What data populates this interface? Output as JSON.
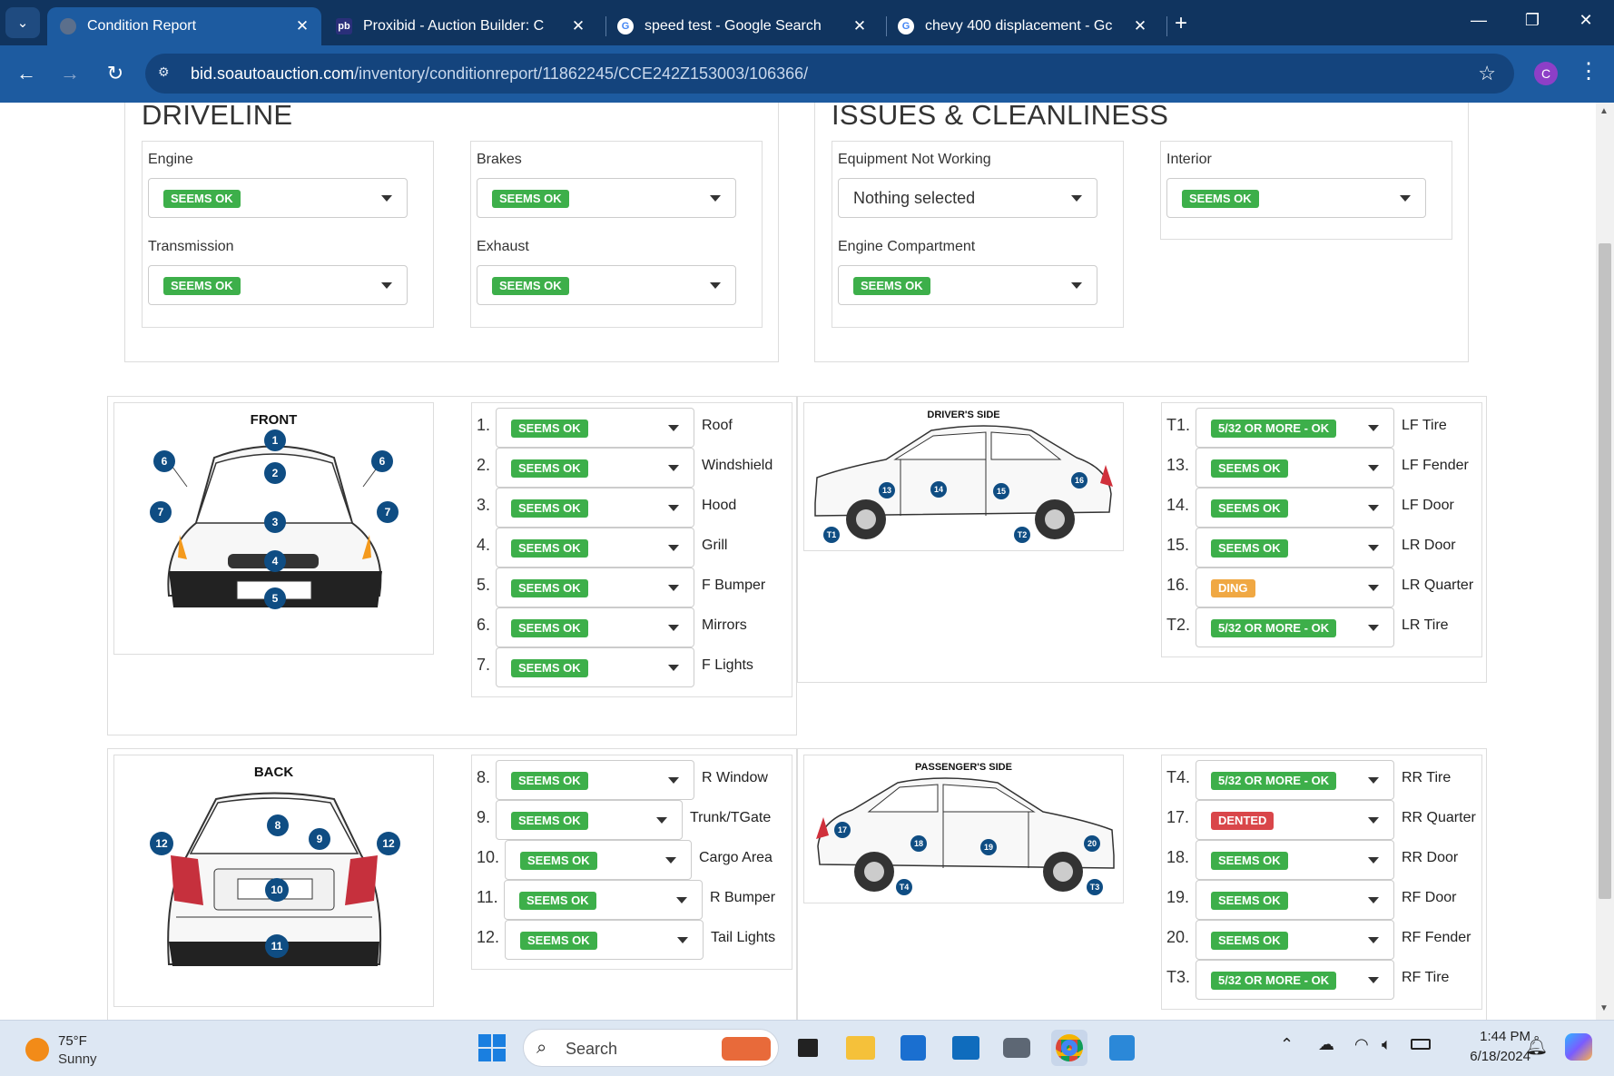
{
  "browser": {
    "tabs": [
      {
        "title": "Condition Report",
        "active": true,
        "favicon": "globe-icon"
      },
      {
        "title": "Proxibid - Auction Builder: C",
        "active": false,
        "favicon": "proxibid-icon"
      },
      {
        "title": "speed test - Google Search",
        "active": false,
        "favicon": "google-icon"
      },
      {
        "title": "chevy 400 displacement - Gc",
        "active": false,
        "favicon": "google-icon"
      }
    ],
    "url_host": "bid.soautoauction.com",
    "url_path": "/inventory/conditionreport/11862245/CCE242Z153003/106366/",
    "profile_initial": "C"
  },
  "colors": {
    "chrome_dark": "#10345f",
    "chrome": "#1d5ba0",
    "ok": "#3daf4a",
    "warn": "#f0a843",
    "bad": "#d9464a"
  },
  "driveline": {
    "title": "DRIVELINE",
    "engine": {
      "label": "Engine",
      "value": "SEEMS OK"
    },
    "brakes": {
      "label": "Brakes",
      "value": "SEEMS OK"
    },
    "transmission": {
      "label": "Transmission",
      "value": "SEEMS OK"
    },
    "exhaust": {
      "label": "Exhaust",
      "value": "SEEMS OK"
    }
  },
  "issues": {
    "title": "ISSUES & CLEANLINESS",
    "equipment": {
      "label": "Equipment Not Working",
      "value": "Nothing selected"
    },
    "interior": {
      "label": "Interior",
      "value": "SEEMS OK"
    },
    "engine_compartment": {
      "label": "Engine Compartment",
      "value": "SEEMS OK"
    }
  },
  "front": {
    "title": "FRONT",
    "items": [
      {
        "num": "1.",
        "value": "SEEMS OK",
        "part": "Roof"
      },
      {
        "num": "2.",
        "value": "SEEMS OK",
        "part": "Windshield"
      },
      {
        "num": "3.",
        "value": "SEEMS OK",
        "part": "Hood"
      },
      {
        "num": "4.",
        "value": "SEEMS OK",
        "part": "Grill"
      },
      {
        "num": "5.",
        "value": "SEEMS OK",
        "part": "F Bumper"
      },
      {
        "num": "6.",
        "value": "SEEMS OK",
        "part": "Mirrors"
      },
      {
        "num": "7.",
        "value": "SEEMS OK",
        "part": "F Lights"
      }
    ]
  },
  "drivers_side": {
    "title": "DRIVER'S SIDE",
    "items": [
      {
        "num": "T1.",
        "value": "5/32 OR MORE - OK",
        "part": "LF Tire",
        "status": "ok"
      },
      {
        "num": "13.",
        "value": "SEEMS OK",
        "part": "LF Fender",
        "status": "ok"
      },
      {
        "num": "14.",
        "value": "SEEMS OK",
        "part": "LF Door",
        "status": "ok"
      },
      {
        "num": "15.",
        "value": "SEEMS OK",
        "part": "LR Door",
        "status": "ok"
      },
      {
        "num": "16.",
        "value": "DING",
        "part": "LR Quarter",
        "status": "warn"
      },
      {
        "num": "T2.",
        "value": "5/32 OR MORE - OK",
        "part": "LR Tire",
        "status": "ok"
      }
    ]
  },
  "back": {
    "title": "BACK",
    "items": [
      {
        "num": "8.",
        "value": "SEEMS OK",
        "part": "R Window"
      },
      {
        "num": "9.",
        "value": "SEEMS OK",
        "part": "Trunk/TGate"
      },
      {
        "num": "10.",
        "value": "SEEMS OK",
        "part": "Cargo Area"
      },
      {
        "num": "11.",
        "value": "SEEMS OK",
        "part": "R Bumper"
      },
      {
        "num": "12.",
        "value": "SEEMS OK",
        "part": "Tail Lights"
      }
    ]
  },
  "passengers_side": {
    "title": "PASSENGER'S SIDE",
    "items": [
      {
        "num": "T4.",
        "value": "5/32 OR MORE - OK",
        "part": "RR Tire",
        "status": "ok"
      },
      {
        "num": "17.",
        "value": "DENTED",
        "part": "RR Quarter",
        "status": "bad"
      },
      {
        "num": "18.",
        "value": "SEEMS OK",
        "part": "RR Door",
        "status": "ok"
      },
      {
        "num": "19.",
        "value": "SEEMS OK",
        "part": "RF Door",
        "status": "ok"
      },
      {
        "num": "20.",
        "value": "SEEMS OK",
        "part": "RF Fender",
        "status": "ok"
      },
      {
        "num": "T3.",
        "value": "5/32 OR MORE - OK",
        "part": "RF Tire",
        "status": "ok"
      }
    ]
  },
  "taskbar": {
    "temperature": "75°F",
    "condition": "Sunny",
    "search_placeholder": "Search",
    "time": "1:44 PM",
    "date": "6/18/2024"
  }
}
